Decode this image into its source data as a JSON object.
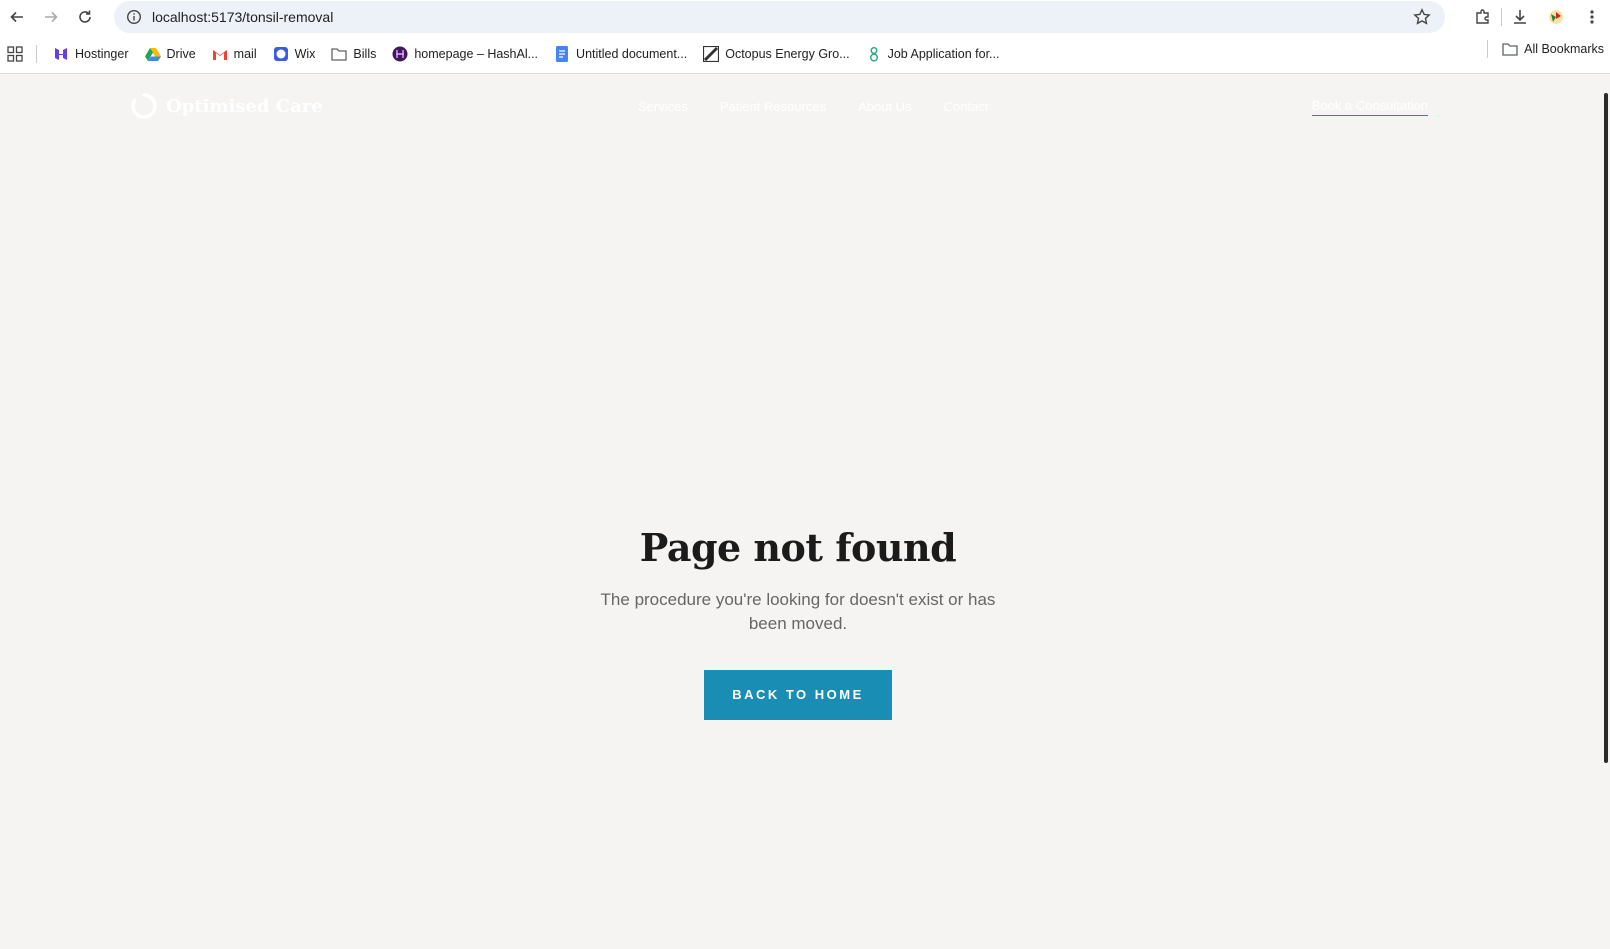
{
  "browser": {
    "url": "localhost:5173/tonsil-removal",
    "bookmarks": [
      {
        "label": "Hostinger",
        "icon": "hostinger-icon",
        "color": "#673de6"
      },
      {
        "label": "Drive",
        "icon": "google-drive-icon",
        "color": "#1fa463"
      },
      {
        "label": "mail",
        "icon": "gmail-icon",
        "color": "#ea4335"
      },
      {
        "label": "Wix",
        "icon": "wix-icon",
        "color": "#3b5bdb"
      },
      {
        "label": "Bills",
        "icon": "folder-icon",
        "color": "#5f6368"
      },
      {
        "label": "homepage – HashAl...",
        "icon": "hashal-icon",
        "color": "#3c1a5b"
      },
      {
        "label": "Untitled document...",
        "icon": "google-docs-icon",
        "color": "#4285f4"
      },
      {
        "label": "Octopus Energy Gro...",
        "icon": "octopus-icon",
        "color": "#333333"
      },
      {
        "label": "Job Application for...",
        "icon": "greenhouse-icon",
        "color": "#24a47f"
      }
    ],
    "all_bookmarks_label": "All Bookmarks"
  },
  "site": {
    "logo_text": "Optimised Care",
    "nav": [
      "Services",
      "Patient Resources",
      "About Us",
      "Contact"
    ],
    "cta": "Book a Consultation",
    "accent": "#1a8db4"
  },
  "content": {
    "heading": "Page not found",
    "message": "The procedure you're looking for doesn't exist or has been moved.",
    "button_label": "BACK TO HOME"
  }
}
